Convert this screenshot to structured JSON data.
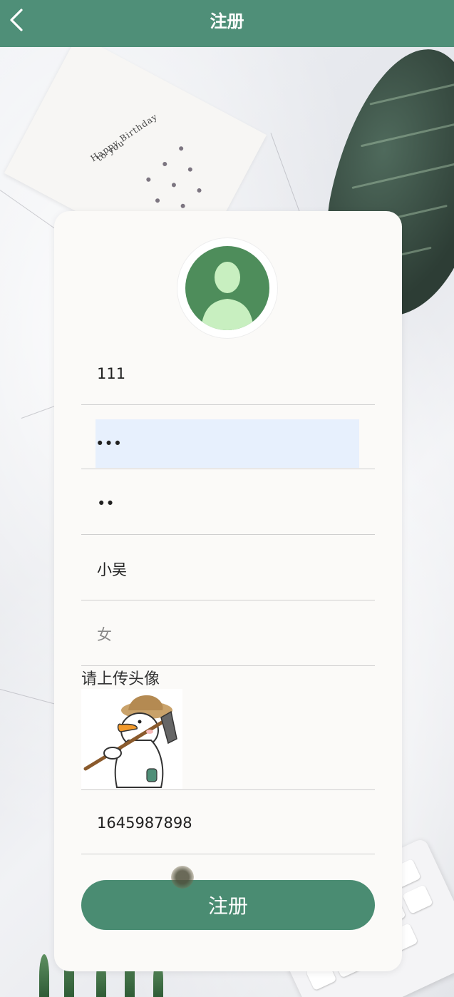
{
  "header": {
    "title": "注册",
    "back_icon": "chevron-left-icon",
    "background_color": "#4f8f78"
  },
  "background": {
    "card_text_1": "Happy Birthday",
    "card_text_2": "to you"
  },
  "form": {
    "avatar_icon": "user-silhouette-icon",
    "fields": [
      {
        "name": "username",
        "value": "111",
        "placeholder": ""
      },
      {
        "name": "password",
        "value": "•••",
        "placeholder": ""
      },
      {
        "name": "confirm-password",
        "value": "••",
        "placeholder": ""
      },
      {
        "name": "nickname",
        "value": "小吴",
        "placeholder": ""
      },
      {
        "name": "gender",
        "value": "",
        "placeholder": "女"
      }
    ],
    "upload_label": "请上传头像",
    "upload_image": "duck-with-hoe-sticker",
    "phone": {
      "value": "1645987898",
      "placeholder": ""
    },
    "submit_label": "注册",
    "accent_color": "#4a8c72"
  }
}
